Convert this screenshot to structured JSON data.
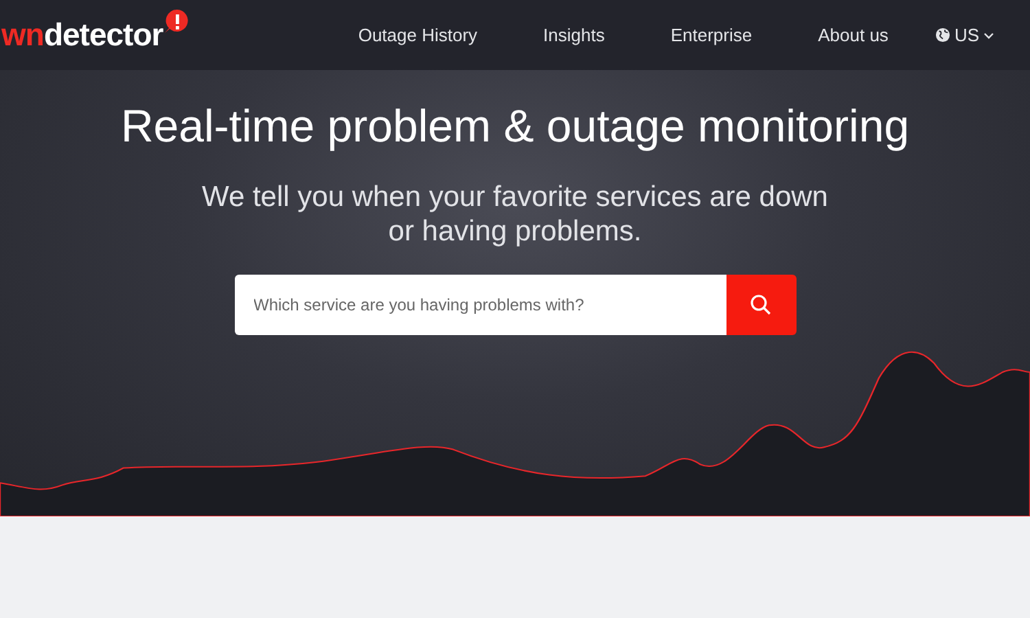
{
  "logo": {
    "accent": "wn",
    "text": "detector"
  },
  "nav": [
    {
      "label": "Outage History"
    },
    {
      "label": "Insights"
    },
    {
      "label": "Enterprise"
    },
    {
      "label": "About us"
    }
  ],
  "region": {
    "label": "US"
  },
  "hero": {
    "title": "Real-time problem & outage monitoring",
    "subtitle_lines": [
      "We tell you when your favorite services are down",
      "or having problems."
    ]
  },
  "search": {
    "placeholder": "Which service are you having problems with?"
  }
}
